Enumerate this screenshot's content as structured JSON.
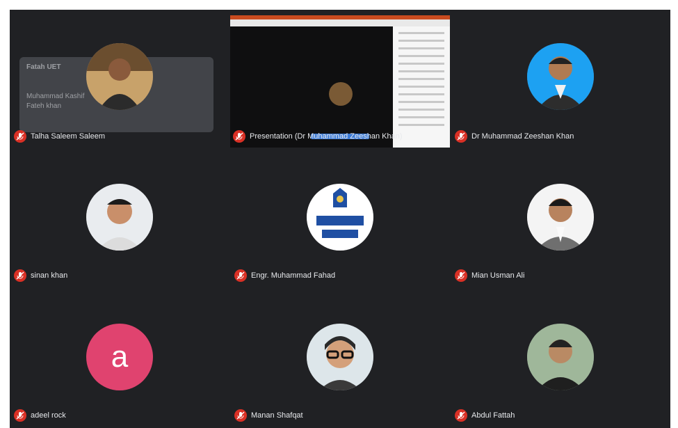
{
  "participants": [
    {
      "name": "Talha Saleem Saleem",
      "avatar": "photo"
    },
    {
      "name": "Dr Muhammad Zeeshan Khan",
      "avatar": "photo"
    },
    {
      "name": "sinan khan",
      "avatar": "photo"
    },
    {
      "name": "Engr. Muhammad Fahad",
      "avatar": "logo"
    },
    {
      "name": "Mian Usman Ali",
      "avatar": "photo"
    },
    {
      "name": "adeel rock",
      "avatar": "letter",
      "letter": "a"
    },
    {
      "name": "Manan Shafqat",
      "avatar": "photo"
    },
    {
      "name": "Abdul Fattah",
      "avatar": "photo"
    }
  ],
  "presentation": {
    "label": "Presentation (Dr Muhammad Zeeshan Khan)"
  },
  "popup": {
    "line1": "Fatah UET",
    "line2": "Muhammad Kashif",
    "line3": "Fateh khan"
  },
  "colors": {
    "background": "#202124",
    "mic_off": "#d93025",
    "letter_avatar": "#e0436f"
  },
  "icons": [
    "mic-off-icon"
  ]
}
